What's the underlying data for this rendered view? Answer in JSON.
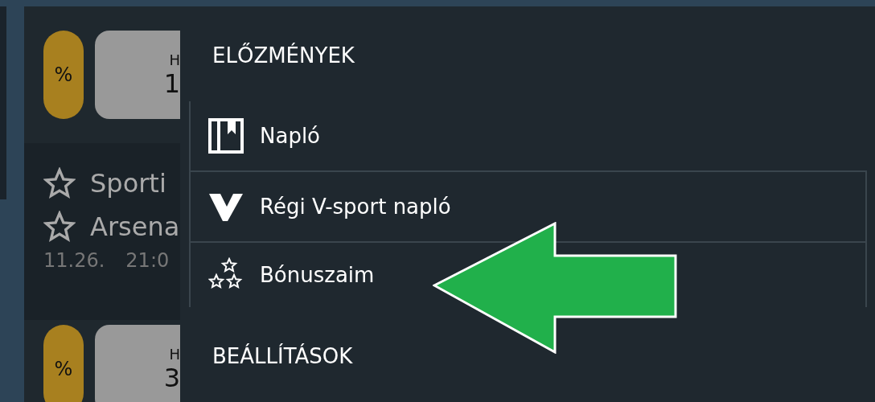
{
  "background": {
    "cards": [
      {
        "badge": "%",
        "label": "H",
        "value": "1"
      }
    ],
    "matches": [
      {
        "team": "Sporti"
      },
      {
        "team": "Arsena"
      }
    ],
    "match_time": {
      "date": "11.26.",
      "time": "21:0"
    },
    "cards_after": [
      {
        "badge": "%",
        "label": "H",
        "value": "3"
      }
    ]
  },
  "menu": {
    "sections": [
      {
        "title": "ELŐZMÉNYEK",
        "items": [
          {
            "kind": "journal",
            "label": "Napló"
          },
          {
            "kind": "vsport",
            "label": "Régi V-sport napló"
          },
          {
            "kind": "bonus",
            "label": "Bónuszaim"
          }
        ]
      },
      {
        "title": "BEÁLLÍTÁSOK"
      }
    ]
  }
}
